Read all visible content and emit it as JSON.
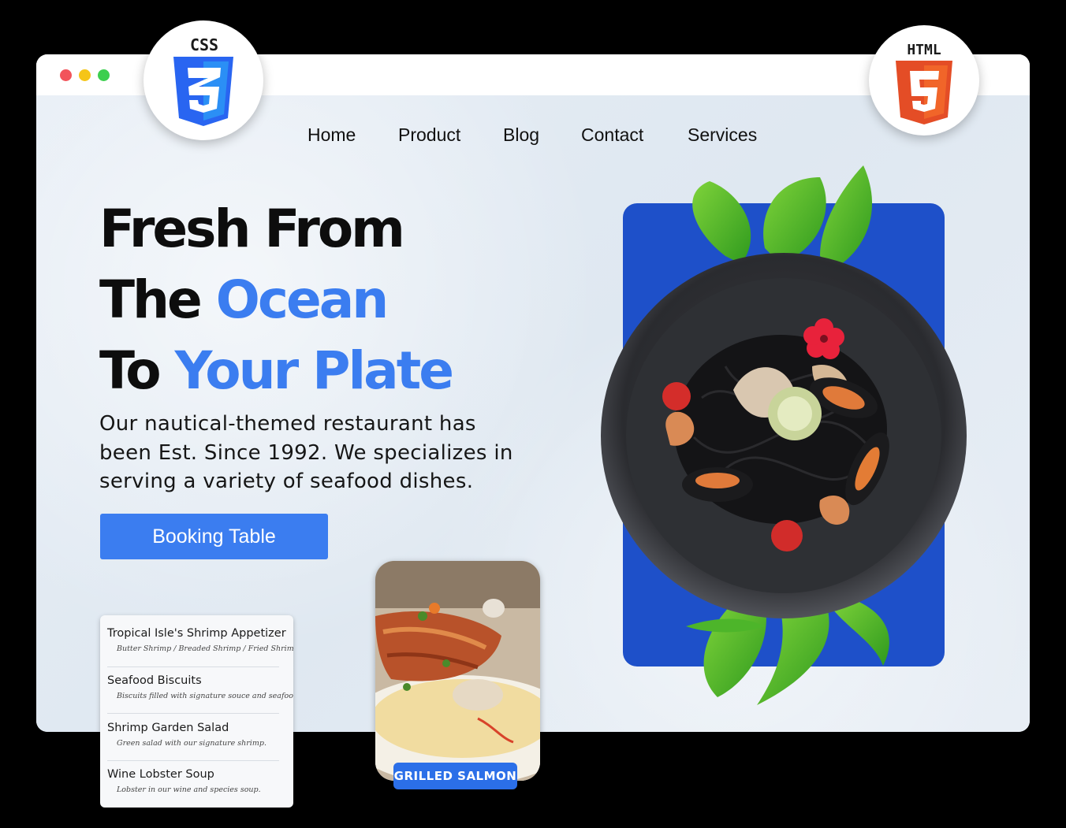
{
  "window": {
    "controls": [
      "close",
      "minimize",
      "maximize"
    ]
  },
  "badges": {
    "css_label": "CSS",
    "css_number": "3",
    "html_label": "HTML",
    "html_number": "5"
  },
  "nav": {
    "items": [
      "Home",
      "Product",
      "Blog",
      "Contact",
      "Services"
    ]
  },
  "hero": {
    "line1": "Fresh From",
    "line2_a": "The ",
    "line2_b": "Ocean",
    "line3_a": "To ",
    "line3_b": "Your Plate",
    "description": "Our nautical-themed restaurant has been Est. Since 1992. We specializes in serving a variety of seafood dishes.",
    "cta_label": "Booking Table"
  },
  "menu": {
    "items": [
      {
        "name": "Tropical Isle's Shrimp Appetizer",
        "desc": "Butter Shrimp / Breaded Shrimp / Fried Shrimp"
      },
      {
        "name": "Seafood Biscuits",
        "desc": "Biscuits filled with signature souce and seafood."
      },
      {
        "name": "Shrimp Garden Salad",
        "desc": "Green salad with our signature shrimp."
      },
      {
        "name": "Wine Lobster Soup",
        "desc": "Lobster in our wine and species soup."
      }
    ]
  },
  "featured": {
    "label": "GRILLED SALMON"
  },
  "colors": {
    "accent": "#3b7df0",
    "panel": "#1e50c9",
    "css_blue": "#2965f1",
    "html_orange": "#e44d26"
  },
  "icons": [
    "css3-logo-icon",
    "html5-logo-icon"
  ]
}
